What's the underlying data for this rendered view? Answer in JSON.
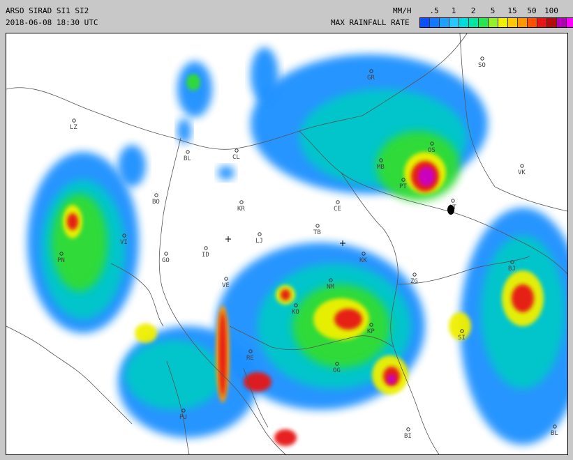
{
  "header": {
    "title": "ARSO SIRAD SI1 SI2",
    "timestamp": "2018-06-08 18:30 UTC",
    "unit": "MM/H",
    "legend_title": "MAX RAINFALL RATE"
  },
  "scale": {
    "labels": [
      ".5",
      "1",
      "2",
      "5",
      "15",
      "50",
      "100"
    ],
    "colors": [
      "#0a50ff",
      "#1478ff",
      "#1ea0ff",
      "#28c8ff",
      "#00dcdc",
      "#00e6a0",
      "#28e650",
      "#96f028",
      "#f0f000",
      "#ffc800",
      "#ff9600",
      "#ff5000",
      "#e61414",
      "#b40a0a",
      "#b400b4",
      "#ff00ff"
    ]
  },
  "cities": [
    {
      "code": "GR"
    },
    {
      "code": "SO"
    },
    {
      "code": "LZ"
    },
    {
      "code": "BL"
    },
    {
      "code": "CL"
    },
    {
      "code": "MB"
    },
    {
      "code": "PT"
    },
    {
      "code": "VK"
    },
    {
      "code": "BO"
    },
    {
      "code": "KR"
    },
    {
      "code": "CE"
    },
    {
      "code": "LJ"
    },
    {
      "code": "TB"
    },
    {
      "code": "VI"
    },
    {
      "code": "PN"
    },
    {
      "code": "GO"
    },
    {
      "code": "ID"
    },
    {
      "code": "KK"
    },
    {
      "code": "ZG"
    },
    {
      "code": "BJ"
    },
    {
      "code": "NM"
    },
    {
      "code": "KO"
    },
    {
      "code": "KP"
    },
    {
      "code": "SI"
    },
    {
      "code": "VE"
    },
    {
      "code": "RE"
    },
    {
      "code": "PU"
    },
    {
      "code": "BI"
    },
    {
      "code": "BL"
    },
    {
      "code": "OG"
    },
    {
      "code": "OS"
    },
    {
      "code": "OT"
    }
  ],
  "radar_colors": {
    "light": "#1e90ff",
    "mid": "#00c8c8",
    "green": "#32dc32",
    "yellow": "#f0f000",
    "orange": "#ff9600",
    "red": "#e61414",
    "dark": "#a00a0a",
    "magenta": "#c800c8"
  }
}
